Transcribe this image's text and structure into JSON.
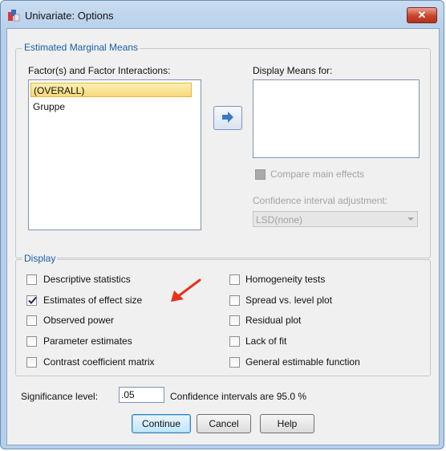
{
  "window": {
    "title": "Univariate: Options",
    "close_glyph": "✕"
  },
  "emm": {
    "group_label": "Estimated Marginal Means",
    "factors_label": "Factor(s) and Factor Interactions:",
    "factors": [
      "(OVERALL)",
      "Gruppe"
    ],
    "selected_index": 0,
    "display_means_label": "Display Means for:",
    "compare_main_effects_label": "Compare main effects",
    "ci_adjustment_label": "Confidence interval adjustment:",
    "ci_adjustment_value": "LSD(none)"
  },
  "display": {
    "group_label": "Display",
    "left": [
      {
        "label": "Descriptive statistics",
        "checked": false
      },
      {
        "label": "Estimates of effect size",
        "checked": true
      },
      {
        "label": "Observed power",
        "checked": false
      },
      {
        "label": "Parameter estimates",
        "checked": false
      },
      {
        "label": "Contrast coefficient matrix",
        "checked": false
      }
    ],
    "right": [
      {
        "label": "Homogeneity tests",
        "checked": false
      },
      {
        "label": "Spread vs. level plot",
        "checked": false
      },
      {
        "label": "Residual plot",
        "checked": false
      },
      {
        "label": "Lack of fit",
        "checked": false
      },
      {
        "label": "General estimable function",
        "checked": false
      }
    ]
  },
  "significance": {
    "label": "Significance level:",
    "value": ".05",
    "ci_text": "Confidence intervals are 95.0 %"
  },
  "buttons": {
    "continue": "Continue",
    "cancel": "Cancel",
    "help": "Help"
  },
  "colors": {
    "annotation_arrow": "#e8311b",
    "selection": "#f7d97a",
    "group_label": "#1a5fa8"
  }
}
